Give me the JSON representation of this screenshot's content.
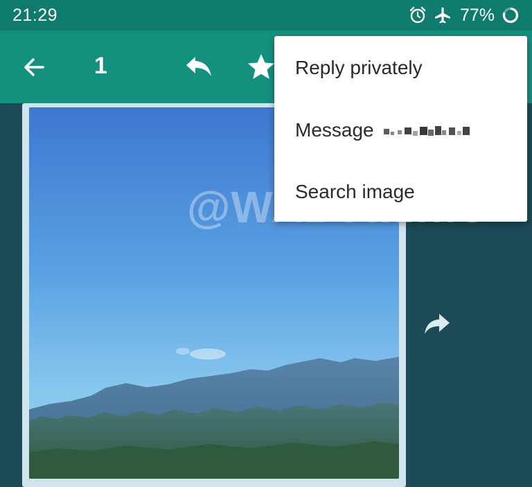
{
  "status_bar": {
    "time": "21:29",
    "battery_percent": "77%",
    "icons": [
      "alarm-icon",
      "airplane-mode-icon",
      "battery-ring-icon"
    ]
  },
  "toolbar": {
    "selected_count": "1",
    "icons": [
      "back-arrow-icon",
      "reply-icon",
      "star-icon"
    ]
  },
  "overflow_menu": {
    "items": [
      {
        "label": "Reply privately"
      },
      {
        "label": "Message",
        "redacted_name": true
      },
      {
        "label": "Search image"
      }
    ]
  },
  "chat": {
    "forward_icon": "forward-icon"
  },
  "watermark": "@WABetaInfo",
  "colors": {
    "status_bar": "#0f7b6c",
    "toolbar": "#14907e",
    "chat_background": "#1c4a56",
    "menu_background": "#ffffff",
    "menu_text": "#2a2a2a"
  }
}
